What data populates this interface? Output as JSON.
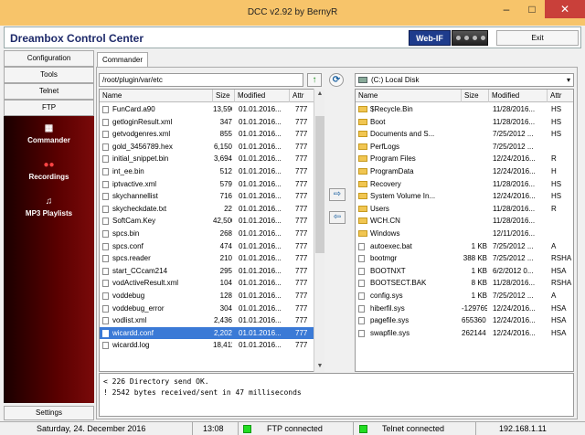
{
  "window": {
    "title": "DCC v2.92 by BernyR"
  },
  "header": {
    "app_title": "Dreambox Control Center",
    "webif_label": "Web-IF",
    "exit_label": "Exit"
  },
  "sidebar": {
    "tabs": [
      "Configuration",
      "Tools",
      "Telnet",
      "FTP"
    ],
    "nav": [
      {
        "label": "Commander",
        "icon": "commander-icon"
      },
      {
        "label": "Recordings",
        "icon": "recordings-icon"
      },
      {
        "label": "MP3 Playlists",
        "icon": "mp3-playlists-icon"
      }
    ],
    "settings_label": "Settings"
  },
  "commander": {
    "tab_label": "Commander",
    "left": {
      "path": "/root/plugin/var/etc",
      "columns": [
        "Name",
        "Size",
        "Modified",
        "Attr"
      ],
      "files": [
        {
          "name": "FunCard.a90",
          "size": "13,590",
          "modified": "01.01.2016...",
          "attr": "777"
        },
        {
          "name": "getloginResult.xml",
          "size": "347",
          "modified": "01.01.2016...",
          "attr": "777"
        },
        {
          "name": "getvodgenres.xml",
          "size": "855",
          "modified": "01.01.2016...",
          "attr": "777"
        },
        {
          "name": "gold_3456789.hex",
          "size": "6,150",
          "modified": "01.01.2016...",
          "attr": "777"
        },
        {
          "name": "initial_snippet.bin",
          "size": "3,694",
          "modified": "01.01.2016...",
          "attr": "777"
        },
        {
          "name": "int_ee.bin",
          "size": "512",
          "modified": "01.01.2016...",
          "attr": "777"
        },
        {
          "name": "iptvactive.xml",
          "size": "579",
          "modified": "01.01.2016...",
          "attr": "777"
        },
        {
          "name": "skychannellist",
          "size": "716",
          "modified": "01.01.2016...",
          "attr": "777"
        },
        {
          "name": "skycheckdate.txt",
          "size": "22",
          "modified": "01.01.2016...",
          "attr": "777"
        },
        {
          "name": "SoftCam.Key",
          "size": "42,500",
          "modified": "01.01.2016...",
          "attr": "777"
        },
        {
          "name": "spcs.bin",
          "size": "268",
          "modified": "01.01.2016...",
          "attr": "777"
        },
        {
          "name": "spcs.conf",
          "size": "474",
          "modified": "01.01.2016...",
          "attr": "777"
        },
        {
          "name": "spcs.reader",
          "size": "210",
          "modified": "01.01.2016...",
          "attr": "777"
        },
        {
          "name": "start_CCcam214",
          "size": "295",
          "modified": "01.01.2016...",
          "attr": "777"
        },
        {
          "name": "vodActiveResult.xml",
          "size": "104",
          "modified": "01.01.2016...",
          "attr": "777"
        },
        {
          "name": "voddebug",
          "size": "128",
          "modified": "01.01.2016...",
          "attr": "777"
        },
        {
          "name": "voddebug_error",
          "size": "304",
          "modified": "01.01.2016...",
          "attr": "777"
        },
        {
          "name": "vodlist.xml",
          "size": "2,436",
          "modified": "01.01.2016...",
          "attr": "777"
        },
        {
          "name": "wicardd.conf",
          "size": "2,202",
          "modified": "01.01.2016...",
          "attr": "777"
        },
        {
          "name": "wicardd.log",
          "size": "18,411",
          "modified": "01.01.2016...",
          "attr": "777"
        }
      ]
    },
    "right": {
      "drive": "(C:) Local Disk",
      "columns": [
        "Name",
        "Size",
        "Modified",
        "Attr"
      ],
      "files": [
        {
          "name": "$Recycle.Bin",
          "size": "",
          "modified": "11/28/2016...",
          "attr": "HS",
          "dir": true
        },
        {
          "name": "Boot",
          "size": "",
          "modified": "11/28/2016...",
          "attr": "HS",
          "dir": true
        },
        {
          "name": "Documents and S...",
          "size": "",
          "modified": "7/25/2012 ...",
          "attr": "HS",
          "dir": true
        },
        {
          "name": "PerfLogs",
          "size": "",
          "modified": "7/25/2012 ...",
          "attr": "",
          "dir": true
        },
        {
          "name": "Program Files",
          "size": "",
          "modified": "12/24/2016...",
          "attr": "R",
          "dir": true
        },
        {
          "name": "ProgramData",
          "size": "",
          "modified": "12/24/2016...",
          "attr": "H",
          "dir": true
        },
        {
          "name": "Recovery",
          "size": "",
          "modified": "11/28/2016...",
          "attr": "HS",
          "dir": true
        },
        {
          "name": "System Volume In...",
          "size": "",
          "modified": "12/24/2016...",
          "attr": "HS",
          "dir": true
        },
        {
          "name": "Users",
          "size": "",
          "modified": "11/28/2016...",
          "attr": "R",
          "dir": true
        },
        {
          "name": "WCH.CN",
          "size": "",
          "modified": "11/28/2016...",
          "attr": "",
          "dir": true
        },
        {
          "name": "Windows",
          "size": "",
          "modified": "12/11/2016...",
          "attr": "",
          "dir": true
        },
        {
          "name": "autoexec.bat",
          "size": "1 KB",
          "modified": "7/25/2012 ...",
          "attr": "A",
          "dir": false
        },
        {
          "name": "bootmgr",
          "size": "388 KB",
          "modified": "7/25/2012 ...",
          "attr": "RSHA",
          "dir": false
        },
        {
          "name": "BOOTNXT",
          "size": "1 KB",
          "modified": "6/2/2012 0...",
          "attr": "HSA",
          "dir": false
        },
        {
          "name": "BOOTSECT.BAK",
          "size": "8 KB",
          "modified": "11/28/2016...",
          "attr": "RSHA",
          "dir": false
        },
        {
          "name": "config.sys",
          "size": "1 KB",
          "modified": "7/25/2012 ...",
          "attr": "A",
          "dir": false
        },
        {
          "name": "hiberfil.sys",
          "size": "-129769...",
          "modified": "12/24/2016...",
          "attr": "HSA",
          "dir": false
        },
        {
          "name": "pagefile.sys",
          "size": "655360 KB",
          "modified": "12/24/2016...",
          "attr": "HSA",
          "dir": false
        },
        {
          "name": "swapfile.sys",
          "size": "262144 KB",
          "modified": "12/24/2016...",
          "attr": "HSA",
          "dir": false
        }
      ]
    },
    "log": [
      "< 226 Directory send OK.",
      "! 2542 bytes received/sent in 47 milliseconds"
    ]
  },
  "status": {
    "date": "Saturday, 24. December 2016",
    "time": "13:08",
    "ftp": "FTP connected",
    "telnet": "Telnet connected",
    "ip": "192.168.1.11"
  }
}
